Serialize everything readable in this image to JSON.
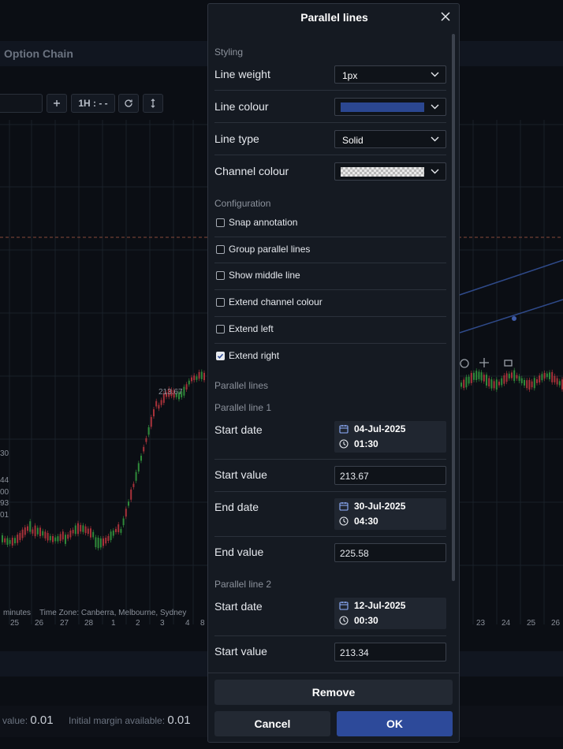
{
  "background": {
    "tab_label": "Option Chain",
    "toolbar": {
      "interval_label": "1H : - -"
    },
    "chart": {
      "price_labels": [
        "213.67",
        "30",
        "44",
        "00",
        "93",
        "01"
      ],
      "timezone_text": "minutes    Time Zone: Canberra, Melbourne, Sydney",
      "dates": [
        "25",
        "26",
        "27",
        "28",
        "1",
        "2",
        "3",
        "4",
        "8",
        "23",
        "24",
        "25",
        "26"
      ]
    },
    "footer": {
      "value_label": "value:",
      "value_amount": "0.01",
      "margin_label": "Initial margin available:",
      "margin_amount": "0.01"
    }
  },
  "dialog": {
    "title": "Parallel lines",
    "styling": {
      "heading": "Styling",
      "line_weight_label": "Line weight",
      "line_weight_value": "1px",
      "line_colour_label": "Line colour",
      "line_colour_value": "#2b4791",
      "line_type_label": "Line type",
      "line_type_value": "Solid",
      "channel_colour_label": "Channel colour"
    },
    "configuration": {
      "heading": "Configuration",
      "options": [
        {
          "label": "Snap annotation",
          "checked": false
        },
        {
          "label": "Group parallel lines",
          "checked": false
        },
        {
          "label": "Show middle line",
          "checked": false
        },
        {
          "label": "Extend channel colour",
          "checked": false
        },
        {
          "label": "Extend left",
          "checked": false
        },
        {
          "label": "Extend right",
          "checked": true
        }
      ]
    },
    "parallel_lines": {
      "heading": "Parallel lines",
      "line1": {
        "heading": "Parallel line 1",
        "start_date_label": "Start date",
        "start_date": "04-Jul-2025",
        "start_time": "01:30",
        "start_value_label": "Start value",
        "start_value": "213.67",
        "end_date_label": "End date",
        "end_date": "30-Jul-2025",
        "end_time": "04:30",
        "end_value_label": "End value",
        "end_value": "225.58"
      },
      "line2": {
        "heading": "Parallel line 2",
        "start_date_label": "Start date",
        "start_date": "12-Jul-2025",
        "start_time": "00:30",
        "start_value_label": "Start value",
        "start_value": "213.34"
      }
    },
    "buttons": {
      "remove": "Remove",
      "cancel": "Cancel",
      "ok": "OK"
    }
  }
}
